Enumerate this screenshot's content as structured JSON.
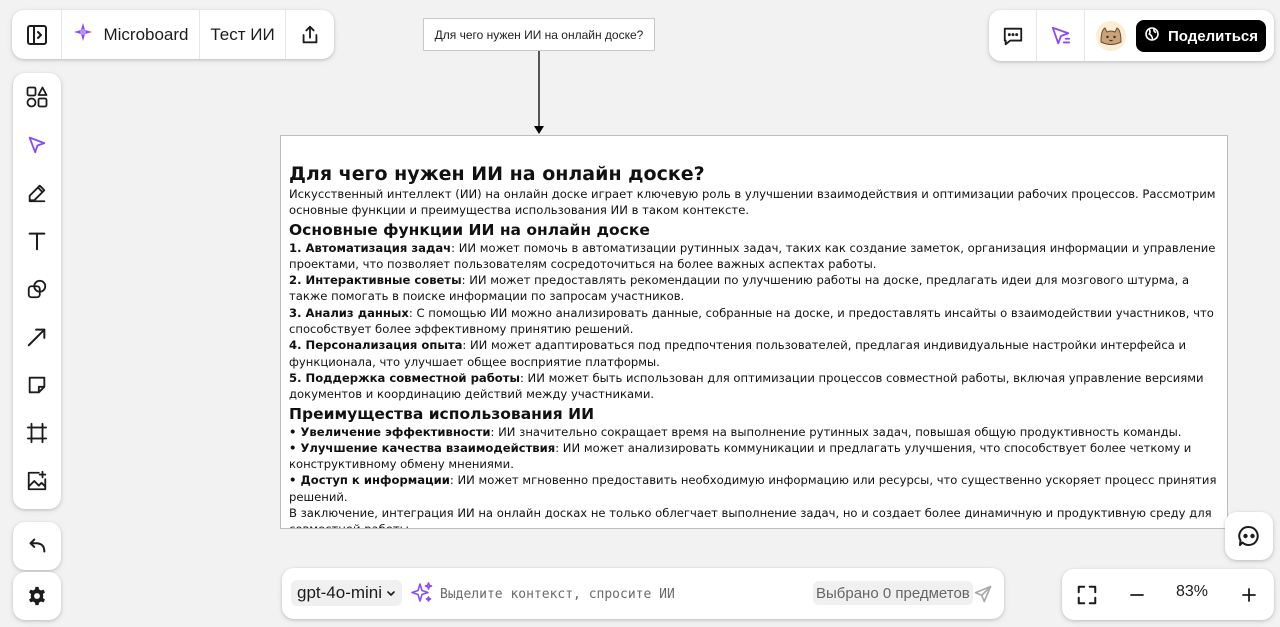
{
  "app": {
    "name": "Microboard",
    "board_name": "Тест ИИ",
    "share_label": "Поделиться",
    "accent_color": "#8a4bff"
  },
  "icons": {
    "toggle_sidebar": "sidebar-toggle-icon",
    "logo": "microboard-logo-icon",
    "export": "share-upload-icon",
    "comments": "comment-icon",
    "ai_cursor": "ai-cursor-icon",
    "avatar": "cat-avatar",
    "globe": "globe-icon",
    "shapes": "shapes-icon",
    "select": "select-cursor-icon",
    "pen": "pen-icon",
    "text": "text-icon",
    "shape": "shape-icon",
    "arrow": "arrow-connector-icon",
    "sticker": "sticky-note-icon",
    "frame": "frame-icon",
    "image": "image-add-icon",
    "undo": "undo-icon",
    "settings": "gear-icon",
    "sparkle": "sparkle-icon",
    "send": "send-icon",
    "fit": "fit-screen-icon",
    "zoom_out": "minus-icon",
    "zoom_in": "plus-icon",
    "chat": "chat-help-icon"
  },
  "question_node": {
    "text": "Для чего нужен ИИ на онлайн доске?"
  },
  "answer": {
    "title": "Для чего нужен ИИ на онлайн доске?",
    "intro": "Искусственный интеллект (ИИ) на онлайн доске играет ключевую роль в улучшении взаимодействия и оптимизации рабочих процессов. Рассмотрим основные функции и преимущества использования ИИ в таком контексте.",
    "functions_heading": "Основные функции ИИ на онлайн доске",
    "functions": [
      {
        "label": "1. Автоматизация задач",
        "text": ": ИИ может помочь в автоматизации рутинных задач, таких как создание заметок, организация информации и управление проектами, что позволяет пользователям сосредоточиться на более важных аспектах работы."
      },
      {
        "label": "2. Интерактивные советы",
        "text": ": ИИ может предоставлять рекомендации по улучшению работы на доске, предлагать идеи для мозгового штурма, а также помогать в поиске информации по запросам участников."
      },
      {
        "label": "3. Анализ данных",
        "text": ": С помощью ИИ можно анализировать данные, собранные на доске, и предоставлять инсайты о взаимодействии участников, что способствует более эффективному принятию решений."
      },
      {
        "label": "4. Персонализация опыта",
        "text": ": ИИ может адаптироваться под предпочтения пользователей, предлагая индивидуальные настройки интерфейса и функционала, что улучшает общее восприятие платформы."
      },
      {
        "label": "5. Поддержка совместной работы",
        "text": ": ИИ может быть использован для оптимизации процессов совместной работы, включая управление версиями документов и координацию действий между участниками."
      }
    ],
    "benefits_heading": "Преимущества использования ИИ",
    "benefits": [
      {
        "label": "• Увеличение эффективности",
        "text": ": ИИ значительно сокращает время на выполнение рутинных задач, повышая общую продуктивность команды."
      },
      {
        "label": "• Улучшение качества взаимодействия",
        "text": ": ИИ может анализировать коммуникации и предлагать улучшения, что способствует более четкому и конструктивному обмену мнениями."
      },
      {
        "label": "• Доступ к информации",
        "text": ": ИИ может мгновенно предоставить необходимую информацию или ресурсы, что существенно ускоряет процесс принятия решений."
      }
    ],
    "conclusion": "В заключение, интеграция ИИ на онлайн досках не только облегчает выполнение задач, но и создает более динамичную и продуктивную среду для совместной работы."
  },
  "ai_bar": {
    "model": "gpt-4o-mini",
    "placeholder": "Выделите контекст, спросите ИИ",
    "value": "",
    "selected_label": "Выбрано 0 предметов"
  },
  "zoom": {
    "level": "83%"
  }
}
